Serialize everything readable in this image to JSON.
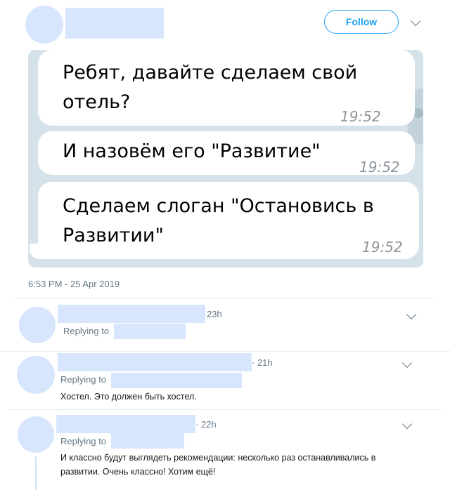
{
  "header": {
    "follow_label": "Follow",
    "colors": {
      "accent": "#1da1f2",
      "redaction": "#d8e6fd",
      "chat_bg": "#d6e2e9"
    }
  },
  "messages": [
    {
      "line1": "Ребят, давайте сделаем свой",
      "line2": "отель?",
      "time": "19:52"
    },
    {
      "line1": "И назовём его \"Развитие\"",
      "time": "19:52"
    },
    {
      "line1": "Сделаем слоган \"Остановись в",
      "line2": "Развитии\"",
      "time": "19:52"
    }
  ],
  "tweet": {
    "timestamp": "6:53 PM - 25 Apr 2019"
  },
  "replies": [
    {
      "time": "23h",
      "replying_to": "Replying to",
      "text": ""
    },
    {
      "time": "· 21h",
      "replying_to": "Replying to",
      "text": "Хостел. Это должен быть хостел."
    },
    {
      "time": "· 22h",
      "replying_to": "Replying to",
      "line1": "И классно будут выглядеть рекомендации: несколько раз останавливались в",
      "line2": "развитии. Очень классно! Хотим ещё!"
    }
  ],
  "icons": [
    "chevron-down-icon",
    "chat-avatar-icon"
  ]
}
